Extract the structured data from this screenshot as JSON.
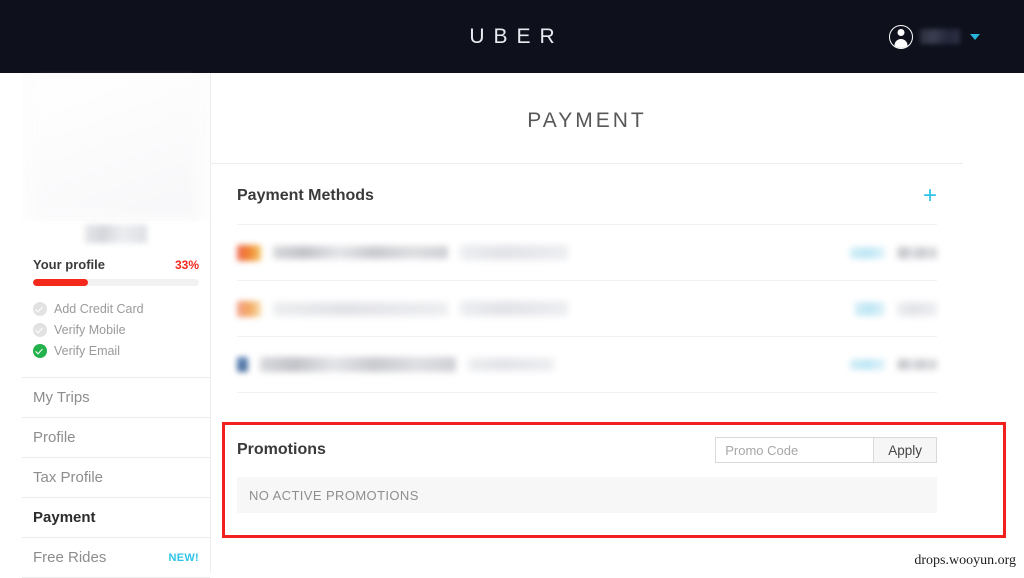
{
  "header": {
    "brand": "UBER",
    "avatar_icon": "user-circle-icon",
    "caret_icon": "chevron-down-icon",
    "username": "",
    "background_color": "#0e101c",
    "accent_color": "#25b5d8"
  },
  "sidebar": {
    "profile": {
      "label": "Your profile",
      "percent": "33%",
      "progress_value": 33,
      "progress_color": "#f4291c",
      "checklist": [
        {
          "label": "Add Credit Card",
          "done": false
        },
        {
          "label": "Verify Mobile",
          "done": false
        },
        {
          "label": "Verify Email",
          "done": true
        }
      ]
    },
    "nav": [
      {
        "label": "My Trips",
        "active": false,
        "badge": ""
      },
      {
        "label": "Profile",
        "active": false,
        "badge": ""
      },
      {
        "label": "Tax Profile",
        "active": false,
        "badge": ""
      },
      {
        "label": "Payment",
        "active": true,
        "badge": ""
      },
      {
        "label": "Free Rides",
        "active": false,
        "badge": "NEW!"
      }
    ]
  },
  "main": {
    "page_title": "PAYMENT",
    "payment_methods": {
      "title": "Payment Methods",
      "add_icon": "plus-icon",
      "add_accent_color": "#2ec5e8",
      "rows": [
        {
          "card_icon": "mastercard-icon",
          "name_redacted": true,
          "detail_redacted": true,
          "edit_redacted": true,
          "remove_redacted": true
        },
        {
          "card_icon": "visa-icon",
          "name_redacted": true,
          "detail_redacted": true,
          "edit_redacted": true,
          "remove_redacted": true
        },
        {
          "card_icon": "paypal-icon",
          "name_redacted": true,
          "detail_redacted": true,
          "edit_redacted": true,
          "remove_redacted": true
        }
      ]
    },
    "promotions": {
      "title": "Promotions",
      "promo_placeholder": "Promo Code",
      "promo_value": "",
      "apply_label": "Apply",
      "empty_message": "NO ACTIVE PROMOTIONS",
      "highlight_color": "#f32020"
    }
  },
  "watermark": "drops.wooyun.org"
}
